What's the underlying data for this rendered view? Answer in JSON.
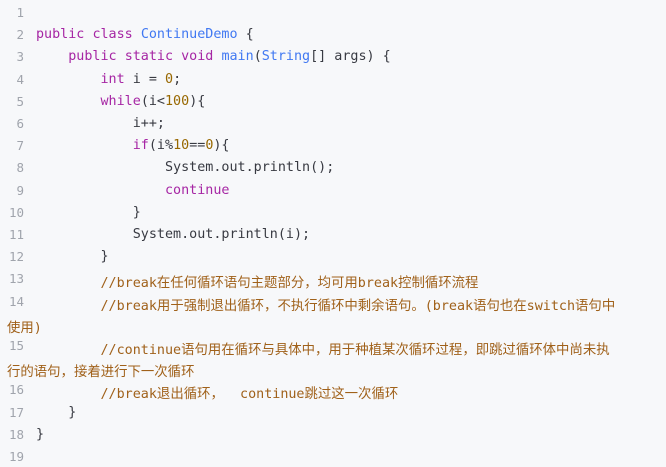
{
  "editor": {
    "lines": [
      {
        "n": "1",
        "tokens": []
      },
      {
        "n": "2",
        "tokens": [
          [
            "kw",
            "public"
          ],
          [
            "plain",
            " "
          ],
          [
            "kw",
            "class"
          ],
          [
            "plain",
            " "
          ],
          [
            "cls",
            "ContinueDemo"
          ],
          [
            "plain",
            " {"
          ]
        ]
      },
      {
        "n": "3",
        "tokens": [
          [
            "plain",
            "    "
          ],
          [
            "kw",
            "public"
          ],
          [
            "plain",
            " "
          ],
          [
            "kw",
            "static"
          ],
          [
            "plain",
            " "
          ],
          [
            "kw",
            "void"
          ],
          [
            "plain",
            " "
          ],
          [
            "cls",
            "main"
          ],
          [
            "plain",
            "("
          ],
          [
            "cls",
            "String"
          ],
          [
            "plain",
            "[] args) {"
          ]
        ]
      },
      {
        "n": "4",
        "tokens": [
          [
            "plain",
            "        "
          ],
          [
            "kw",
            "int"
          ],
          [
            "plain",
            " i = "
          ],
          [
            "num",
            "0"
          ],
          [
            "plain",
            ";"
          ]
        ]
      },
      {
        "n": "5",
        "tokens": [
          [
            "plain",
            "        "
          ],
          [
            "kw",
            "while"
          ],
          [
            "plain",
            "(i<"
          ],
          [
            "num",
            "100"
          ],
          [
            "plain",
            "){"
          ]
        ]
      },
      {
        "n": "6",
        "tokens": [
          [
            "plain",
            "            i++;"
          ]
        ]
      },
      {
        "n": "7",
        "tokens": [
          [
            "plain",
            "            "
          ],
          [
            "kw",
            "if"
          ],
          [
            "plain",
            "(i%"
          ],
          [
            "num",
            "10"
          ],
          [
            "plain",
            "=="
          ],
          [
            "num",
            "0"
          ],
          [
            "plain",
            "){"
          ]
        ]
      },
      {
        "n": "8",
        "tokens": [
          [
            "plain",
            "                System.out.println();"
          ]
        ]
      },
      {
        "n": "9",
        "tokens": [
          [
            "plain",
            "                "
          ],
          [
            "kw",
            "continue"
          ]
        ]
      },
      {
        "n": "10",
        "tokens": [
          [
            "plain",
            "            }"
          ]
        ]
      },
      {
        "n": "11",
        "tokens": [
          [
            "plain",
            "            System.out.println(i);"
          ]
        ]
      },
      {
        "n": "12",
        "tokens": [
          [
            "plain",
            "        }"
          ]
        ]
      },
      {
        "n": "13",
        "tokens": [
          [
            "cmt",
            "        //break在任何循环语句主题部分，均可用break控制循环流程"
          ]
        ]
      },
      {
        "n": "14",
        "tokens": [
          [
            "cmt",
            "        //break用于强制退出循环，不执行循环中剩余语句。(break语句也在switch语句中"
          ]
        ],
        "wrap": "使用)"
      },
      {
        "n": "15",
        "tokens": [
          [
            "cmt",
            "        //continue语句用在循环与具体中，用于种植某次循环过程，即跳过循环体中尚未执"
          ]
        ],
        "wrap": "行的语句，接着进行下一次循环"
      },
      {
        "n": "16",
        "tokens": [
          [
            "cmt",
            "        //break退出循环，  continue跳过这一次循环"
          ]
        ]
      },
      {
        "n": "17",
        "tokens": [
          [
            "plain",
            "    }"
          ]
        ]
      },
      {
        "n": "18",
        "tokens": [
          [
            "plain",
            "}"
          ]
        ]
      },
      {
        "n": "19",
        "tokens": []
      }
    ]
  }
}
